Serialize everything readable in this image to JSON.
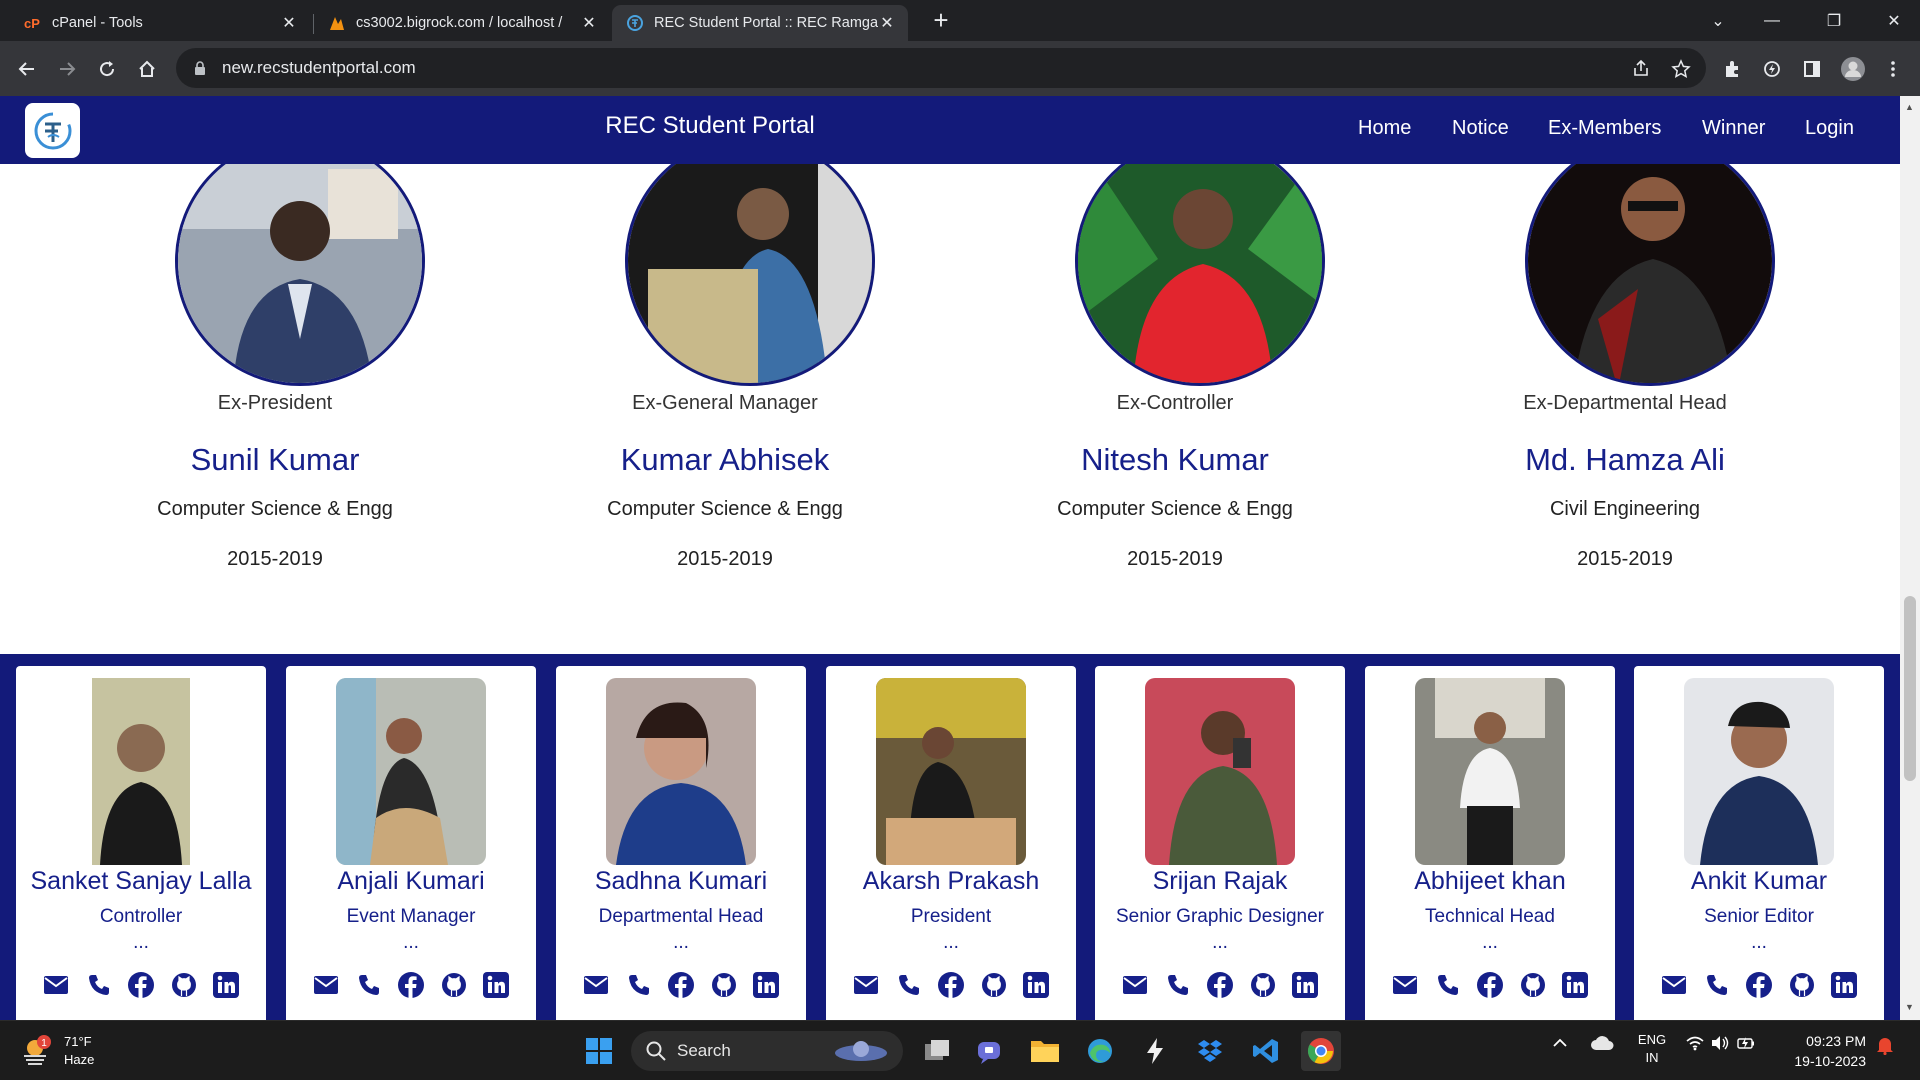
{
  "browser": {
    "tabs": [
      {
        "title": "cPanel - Tools",
        "icon": "cpanel-icon"
      },
      {
        "title": "cs3002.bigrock.com / localhost /",
        "icon": "phpmyadmin-icon"
      },
      {
        "title": "REC Student Portal :: REC Ramga",
        "icon": "portal-favicon-icon"
      }
    ],
    "url": "new.recstudentportal.com"
  },
  "site": {
    "title": "REC Student Portal",
    "nav": [
      "Home",
      "Notice",
      "Ex-Members",
      "Winner",
      "Login"
    ],
    "colors": {
      "primary": "#131a7a",
      "accent_text": "#16208a"
    }
  },
  "ex_members": [
    {
      "role": "Ex-President",
      "name": "Sunil Kumar",
      "dept": "Computer Science & Engg",
      "year": "2015-2019"
    },
    {
      "role": "Ex-General Manager",
      "name": "Kumar Abhisek",
      "dept": "Computer Science & Engg",
      "year": "2015-2019"
    },
    {
      "role": "Ex-Controller",
      "name": "Nitesh Kumar",
      "dept": "Computer Science & Engg",
      "year": "2015-2019"
    },
    {
      "role": "Ex-Departmental Head",
      "name": "Md. Hamza Ali",
      "dept": "Civil Engineering",
      "year": "2015-2019"
    }
  ],
  "team": [
    {
      "name": "Sanket Sanjay Lalla",
      "role": "Controller",
      "more": "..."
    },
    {
      "name": "Anjali Kumari",
      "role": "Event Manager",
      "more": "..."
    },
    {
      "name": "Sadhna Kumari",
      "role": "Departmental Head",
      "more": "..."
    },
    {
      "name": "Akarsh Prakash",
      "role": "President",
      "more": "..."
    },
    {
      "name": "Srijan Rajak",
      "role": "Senior Graphic Designer",
      "more": "..."
    },
    {
      "name": "Abhijeet khan",
      "role": "Technical Head",
      "more": "..."
    },
    {
      "name": "Ankit Kumar",
      "role": "Senior Editor",
      "more": "..."
    }
  ],
  "social_icons": [
    "email-icon",
    "phone-icon",
    "facebook-icon",
    "github-icon",
    "linkedin-icon"
  ],
  "taskbar": {
    "weather": {
      "temp": "71°F",
      "condition": "Haze",
      "badge": "1"
    },
    "search_label": "Search",
    "language": {
      "lang": "ENG",
      "region": "IN"
    },
    "time": "09:23 PM",
    "date": "19-10-2023"
  }
}
